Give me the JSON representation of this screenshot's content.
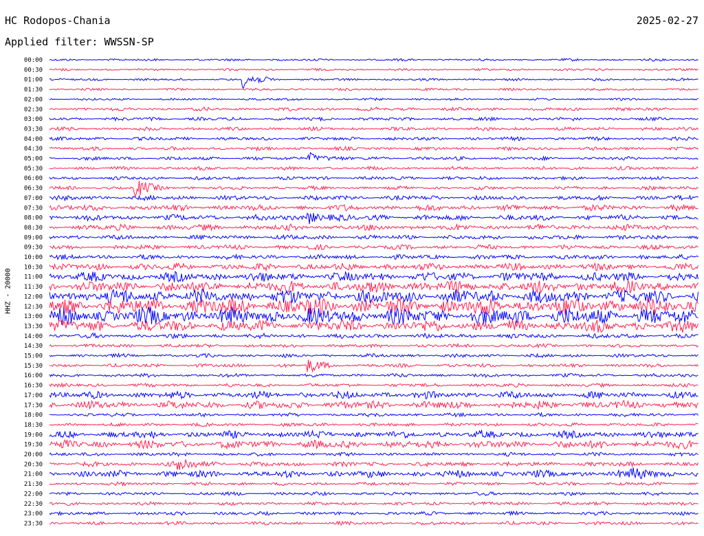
{
  "header": {
    "station": "HC Rodopos-Chania",
    "date": "2025-02-27",
    "filter": "Applied filter: WWSSN-SP",
    "channel": "HHZ - 20000"
  },
  "colors": {
    "trace_a": "#0000ff",
    "trace_b": "#ff2050"
  },
  "chart_data": {
    "type": "helicorder",
    "title": "HC Rodopos-Chania",
    "date": "2025-02-27",
    "filter": "WWSSN-SP",
    "ylabel": "HHZ - 20000",
    "row_labels": [
      "00:00",
      "00:30",
      "01:00",
      "01:30",
      "02:00",
      "02:30",
      "03:00",
      "03:30",
      "04:00",
      "04:30",
      "05:00",
      "05:30",
      "06:00",
      "06:30",
      "07:00",
      "07:30",
      "08:00",
      "08:30",
      "09:00",
      "09:30",
      "10:00",
      "10:30",
      "11:00",
      "11:30",
      "12:00",
      "12:30",
      "13:00",
      "13:30",
      "14:00",
      "14:30",
      "15:00",
      "15:30",
      "16:00",
      "16:30",
      "17:00",
      "17:30",
      "18:00",
      "18:30",
      "19:00",
      "19:30",
      "20:00",
      "20:30",
      "21:00",
      "21:30",
      "22:00",
      "22:30",
      "23:00",
      "23:30"
    ],
    "row_minutes": 30,
    "row_amplitude": [
      2,
      2,
      2,
      2,
      2,
      3,
      3,
      3,
      3,
      3,
      3,
      3,
      3,
      3,
      4,
      5,
      5,
      5,
      4,
      4,
      4,
      6,
      8,
      10,
      12,
      14,
      14,
      10,
      4,
      3,
      3,
      3,
      3,
      3,
      6,
      7,
      3,
      3,
      6,
      7,
      3,
      4,
      6,
      3,
      3,
      3,
      3,
      3
    ],
    "events": [
      {
        "row": 2,
        "minute": 9,
        "strength": 4
      },
      {
        "row": 10,
        "minute": 12,
        "strength": 3
      },
      {
        "row": 13,
        "minute": 4,
        "strength": 4
      },
      {
        "row": 16,
        "minute": 12,
        "strength": 3
      },
      {
        "row": 31,
        "minute": 12,
        "strength": 3
      },
      {
        "row": 41,
        "minute": 6,
        "strength": 4
      },
      {
        "row": 42,
        "minute": 27,
        "strength": 3
      }
    ],
    "grid": false
  }
}
